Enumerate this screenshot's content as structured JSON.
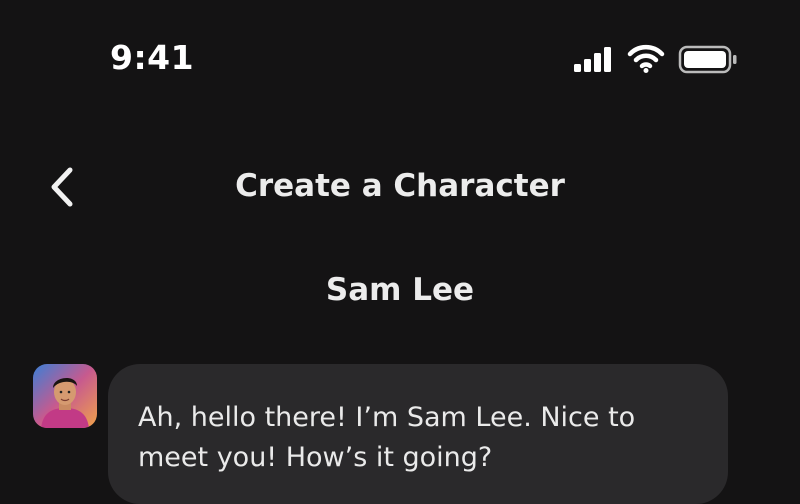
{
  "status_bar": {
    "time": "9:41",
    "icons": [
      "cellular-signal-icon",
      "wifi-icon",
      "battery-icon"
    ]
  },
  "header": {
    "back_icon": "chevron-left-icon",
    "title": "Create a Character"
  },
  "character": {
    "name": "Sam Lee"
  },
  "messages": [
    {
      "sender": "Sam Lee",
      "avatar": "avatar-portrait",
      "text": "Ah, hello there! I’m Sam Lee. Nice to meet you! How’s it going?"
    }
  ],
  "colors": {
    "background": "#141314",
    "bubble": "#2a292b",
    "text": "#eaeaea"
  }
}
